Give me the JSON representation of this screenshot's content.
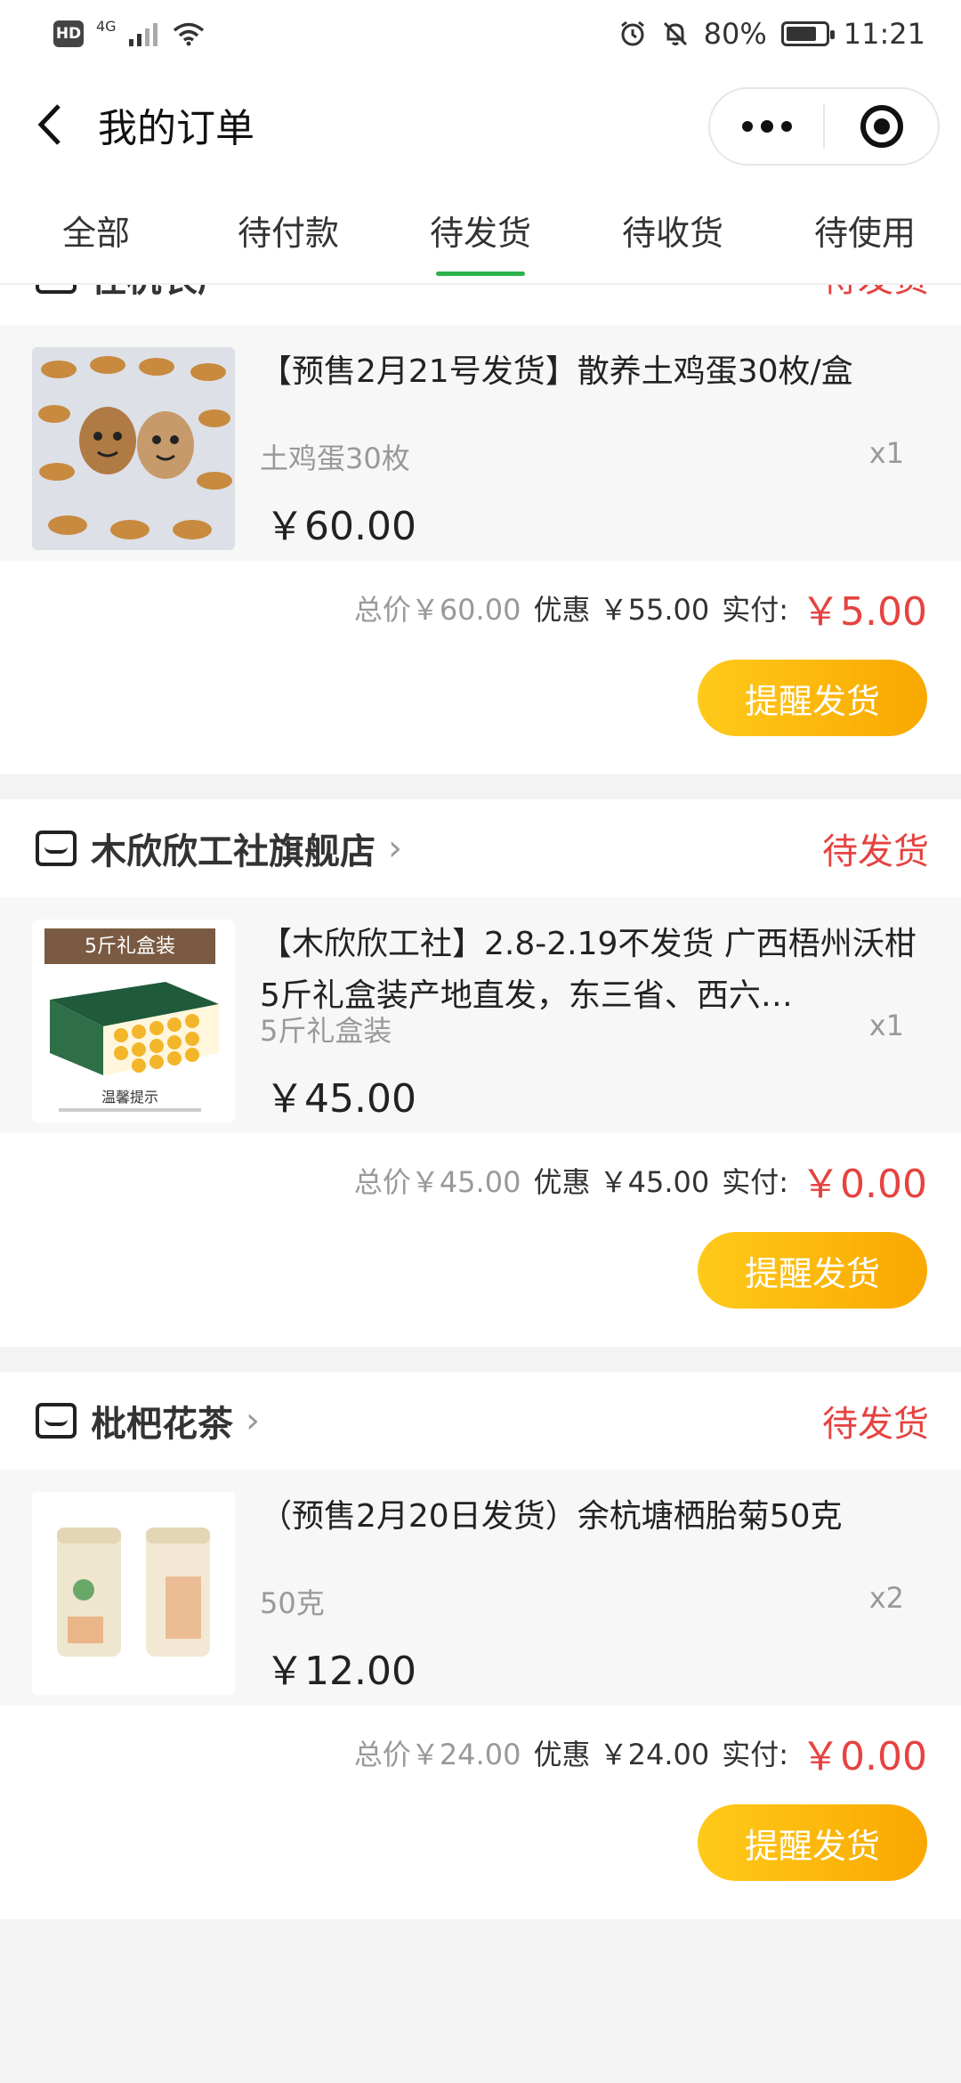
{
  "status_bar": {
    "hd": "HD",
    "network": "4G",
    "battery": "80%",
    "time": "11:21"
  },
  "header": {
    "title": "我的订单",
    "more": "•••"
  },
  "tabs": [
    {
      "label": "全部"
    },
    {
      "label": "待付款"
    },
    {
      "label": "待发货"
    },
    {
      "label": "待收货"
    },
    {
      "label": "待使用"
    }
  ],
  "orders": [
    {
      "shop": "径杭农产",
      "status": "待发货",
      "title": "【预售2月21号发货】散养土鸡蛋30枚/盒",
      "spec": "土鸡蛋30枚",
      "qty": "x1",
      "price": "￥60.00",
      "total": "总价￥60.00",
      "discount": "优惠 ￥55.00",
      "pay_label": "实付:",
      "pay": "￥5.00",
      "button": "提醒发货"
    },
    {
      "shop": "木欣欣工社旗舰店",
      "status": "待发货",
      "title": "【木欣欣工社】2.8-2.19不发货 广西梧州沃柑5斤礼盒装产地直发，东三省、西六…",
      "spec": "5斤礼盒装",
      "qty": "x1",
      "price": "￥45.00",
      "total": "总价￥45.00",
      "discount": "优惠 ￥45.00",
      "pay_label": "实付:",
      "pay": "￥0.00",
      "button": "提醒发货",
      "image_text": "5斤礼盒装",
      "image_note": "温馨提示"
    },
    {
      "shop": "枇杷花茶",
      "status": "待发货",
      "title": "（预售2月20日发货）余杭塘栖胎菊50克",
      "spec": "50克",
      "qty": "x2",
      "price": "￥12.00",
      "total": "总价￥24.00",
      "discount": "优惠 ￥24.00",
      "pay_label": "实付:",
      "pay": "￥0.00",
      "button": "提醒发货"
    }
  ],
  "colors": {
    "accent_green": "#2bb24c",
    "status_red": "#e64340",
    "button_yellow": "#f9a800"
  }
}
